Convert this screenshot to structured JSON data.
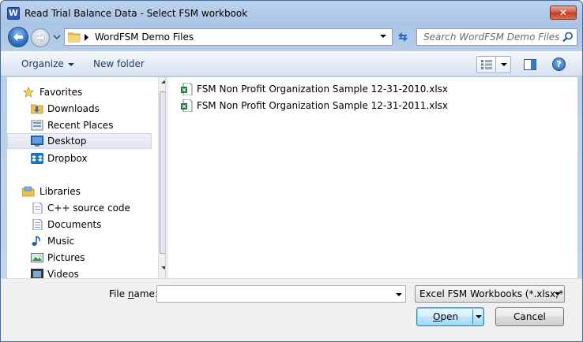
{
  "window": {
    "title": "Read Trial Balance Data - Select FSM workbook",
    "app_icon_letter": "W",
    "close_glyph": "✕"
  },
  "nav": {
    "path_segment": "WordFSM Demo Files",
    "search_placeholder": "Search WordFSM Demo Files"
  },
  "toolbar": {
    "organize_label": "Organize",
    "new_folder_label": "New folder",
    "help_glyph": "?"
  },
  "sidebar": {
    "items": [
      {
        "label": "Favorites",
        "icon": "star-icon",
        "group": true
      },
      {
        "label": "Downloads",
        "icon": "downloads-folder-icon"
      },
      {
        "label": "Recent Places",
        "icon": "recent-places-icon"
      },
      {
        "label": "Desktop",
        "icon": "desktop-icon",
        "selected": true
      },
      {
        "label": "Dropbox",
        "icon": "dropbox-icon"
      },
      {
        "label": "Libraries",
        "icon": "libraries-icon",
        "group": true
      },
      {
        "label": "C++ source code",
        "icon": "document-library-icon"
      },
      {
        "label": "Documents",
        "icon": "documents-icon"
      },
      {
        "label": "Music",
        "icon": "music-icon"
      },
      {
        "label": "Pictures",
        "icon": "pictures-icon"
      },
      {
        "label": "Videos",
        "icon": "videos-icon"
      }
    ]
  },
  "files": [
    {
      "name": "FSM Non Profit Organization Sample 12-31-2010.xlsx",
      "icon": "excel-file-icon"
    },
    {
      "name": "FSM Non Profit Organization Sample 12-31-2011.xlsx",
      "icon": "excel-file-icon"
    }
  ],
  "footer": {
    "filename_label_pre": "File ",
    "filename_label_key": "n",
    "filename_label_post": "ame:",
    "filename_value": "",
    "filetype_selected": "Excel FSM Workbooks (*.xlsx;*.x",
    "open_label_key": "O",
    "open_label_post": "pen",
    "cancel_label": "Cancel"
  },
  "colors": {
    "accent": "#3c7fb1",
    "selection": "#dfe6ef",
    "toolbar_text": "#1e395b"
  }
}
